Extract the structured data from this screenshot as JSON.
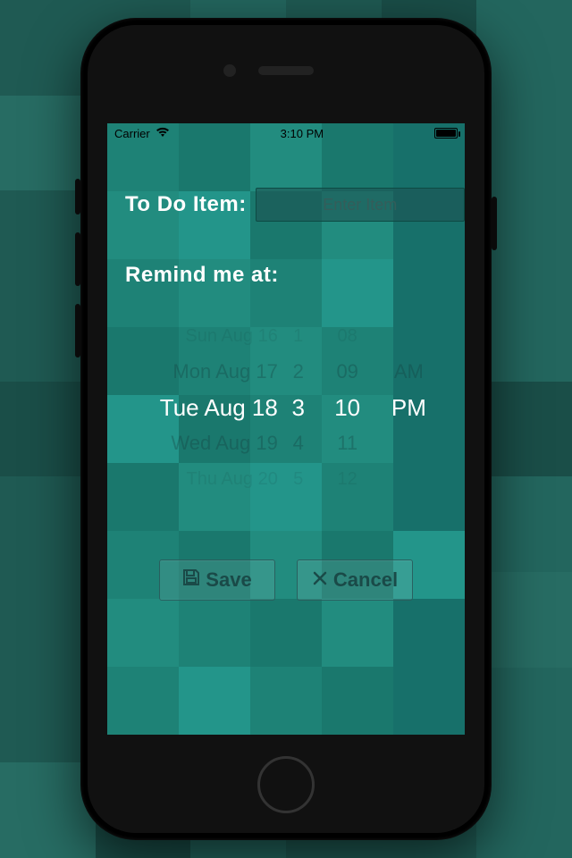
{
  "status": {
    "carrier": "Carrier",
    "time": "3:10 PM"
  },
  "form": {
    "todo_label": "To Do Item:",
    "todo_placeholder": "Enter Item",
    "todo_value": "",
    "remind_label": "Remind me at:"
  },
  "picker": {
    "date": {
      "m2": "Sun Aug 16",
      "m1": "Mon Aug 17",
      "sel": "Tue Aug 18",
      "p1": "Wed Aug 19",
      "p2": "Thu Aug 20"
    },
    "hour": {
      "m2": "1",
      "m1": "2",
      "sel": "3",
      "p1": "4",
      "p2": "5"
    },
    "minute": {
      "m2": "08",
      "m1": "09",
      "sel": "10",
      "p1": "11",
      "p2": "12"
    },
    "ampm": {
      "m1": "AM",
      "sel": "PM"
    }
  },
  "buttons": {
    "save": "Save",
    "cancel": "Cancel"
  }
}
